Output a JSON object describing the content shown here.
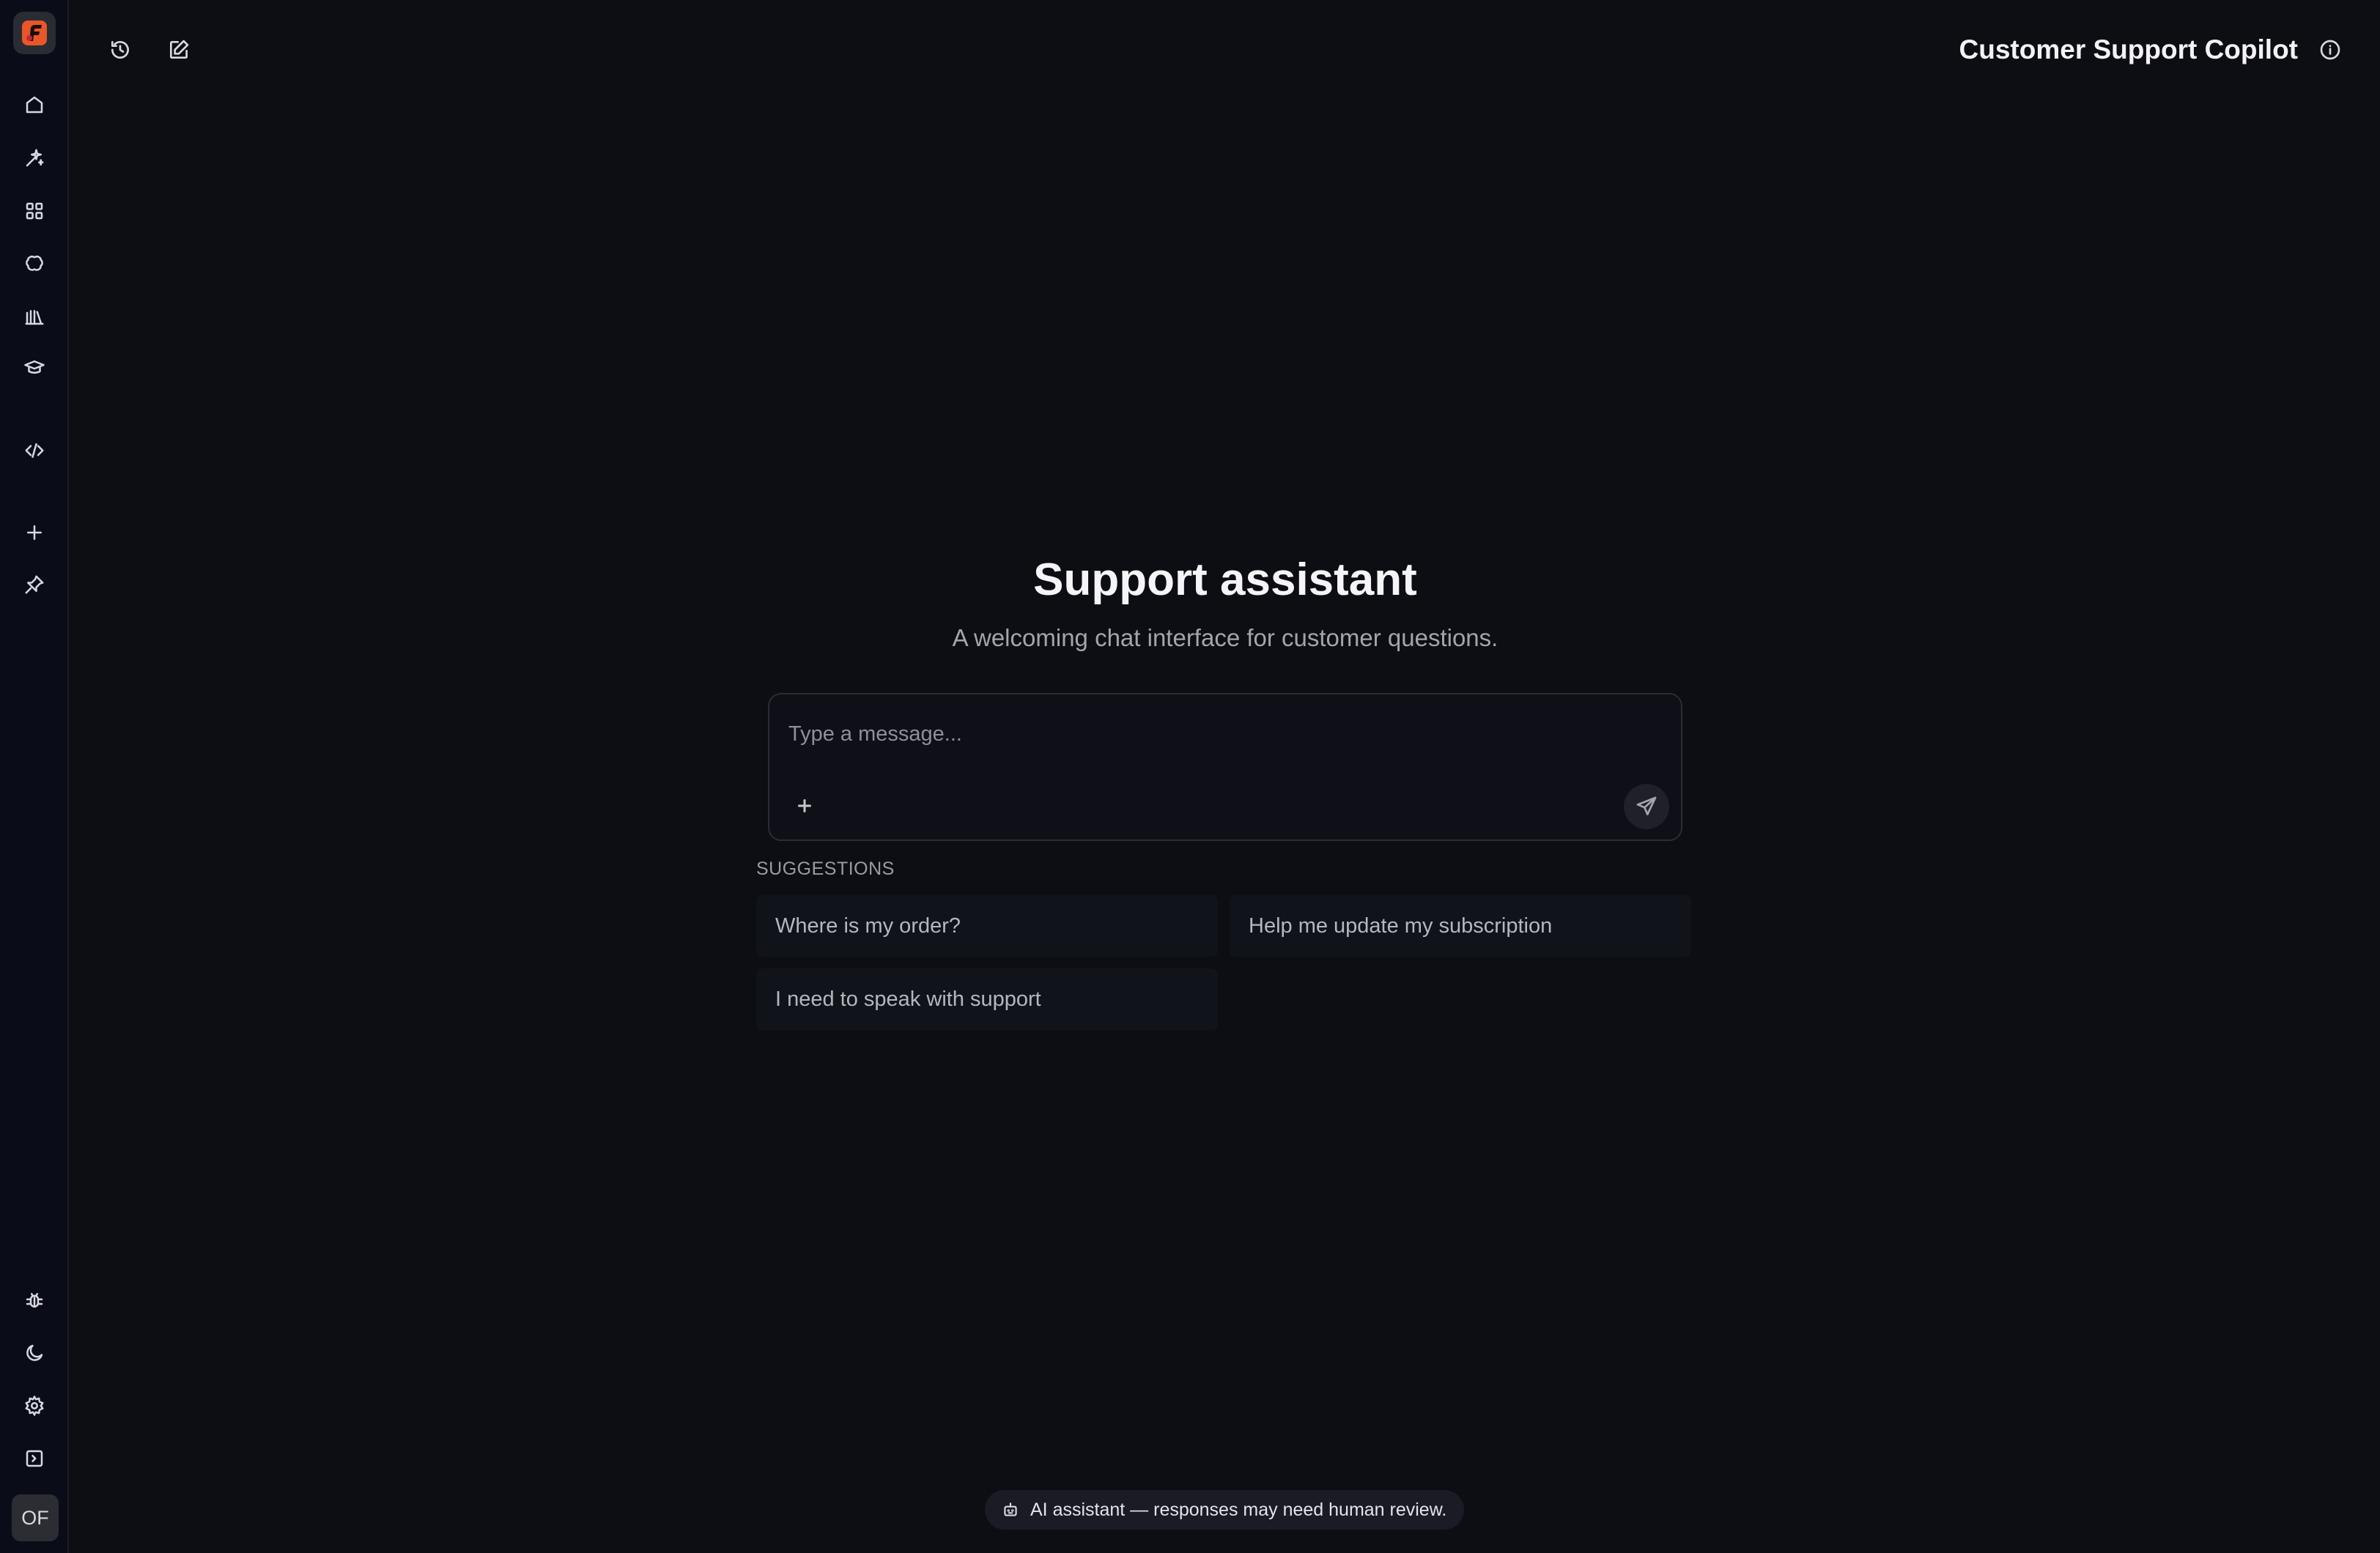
{
  "app": {
    "title": "Customer Support Copilot",
    "accent_color": "#e8562a"
  },
  "sidebar": {
    "top_items": [
      {
        "icon": "home-icon",
        "label": "Home"
      },
      {
        "icon": "sparkles-icon",
        "label": "Assistants"
      },
      {
        "icon": "apps-grid-icon",
        "label": "Apps"
      },
      {
        "icon": "brain-icon",
        "label": "Models"
      },
      {
        "icon": "library-icon",
        "label": "Library"
      },
      {
        "icon": "graduation-cap-icon",
        "label": "Learn"
      },
      {
        "icon": "code-icon",
        "label": "Developer"
      },
      {
        "icon": "plus-icon",
        "label": "New"
      },
      {
        "icon": "pin-icon",
        "label": "Pinned"
      }
    ],
    "bottom_items": [
      {
        "icon": "bug-icon",
        "label": "Report bug"
      },
      {
        "icon": "moon-icon",
        "label": "Theme"
      },
      {
        "icon": "gear-icon",
        "label": "Settings"
      },
      {
        "icon": "expand-sidebar-icon",
        "label": "Expand"
      }
    ],
    "avatar_initials": "OF"
  },
  "header": {
    "history_icon": "history-icon",
    "new_chat_icon": "edit-icon",
    "info_icon": "info-icon"
  },
  "hero": {
    "title": "Support assistant",
    "subtitle": "A welcoming chat interface for customer questions."
  },
  "composer": {
    "placeholder": "Type a message...",
    "value": ""
  },
  "suggestions": {
    "heading": "SUGGESTIONS",
    "items": [
      "Where is my order?",
      "Help me update my subscription",
      "I need to speak with support"
    ]
  },
  "footer": {
    "notice": "AI assistant — responses may need human review."
  }
}
